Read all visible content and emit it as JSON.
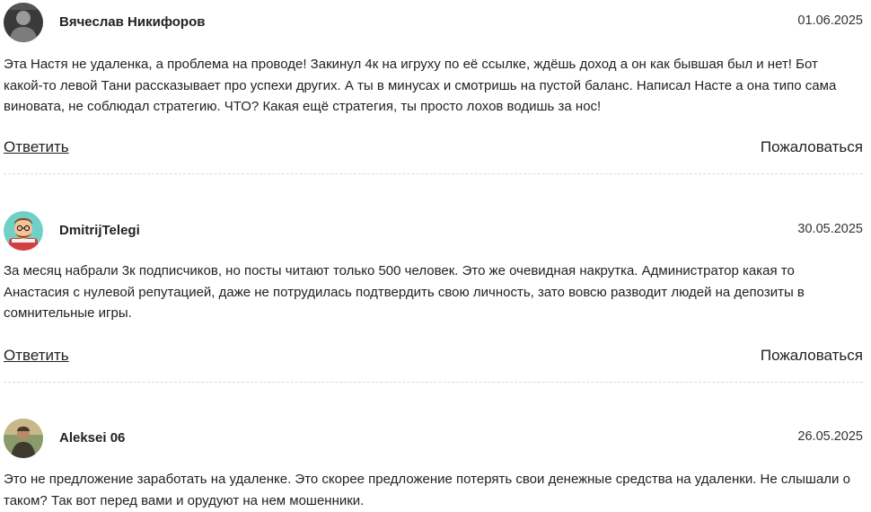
{
  "comments": [
    {
      "author": "Вячеслав Никифоров",
      "date": "01.06.2025",
      "text": "Эта Настя не удаленка, а проблема на проводе! Закинул 4к на игруху по её ссылке, ждёшь доход а он как бывшая был и нет! Бот какой-то левой Тани рассказывает про успехи других. А ты в минусах и смотришь на пустой баланс. Написал Насте а она типо сама виновата, не соблюдал стратегию. ЧТО? Какая ещё стратегия, ты просто лохов водишь за нос!",
      "reply_label": "Ответить",
      "report_label": "Пожаловаться"
    },
    {
      "author": "DmitrijTelegi",
      "date": "30.05.2025",
      "text": "За месяц набрали 3к подписчиков, но посты читают только 500 человек. Это же очевидная накрутка. Администратор какая то Анастасия с нулевой репутацией, даже не потрудилась подтвердить свою личность, зато вовсю разводит людей на депозиты в сомнительные игры.",
      "reply_label": "Ответить",
      "report_label": "Пожаловаться"
    },
    {
      "author": "Aleksei 06",
      "date": "26.05.2025",
      "text": "Это не предложение заработать на удаленке. Это скорее предложение потерять свои денежные средства на удаленки. Не слышали о таком? Так вот перед вами и орудуют на нем мошенники."
    }
  ]
}
